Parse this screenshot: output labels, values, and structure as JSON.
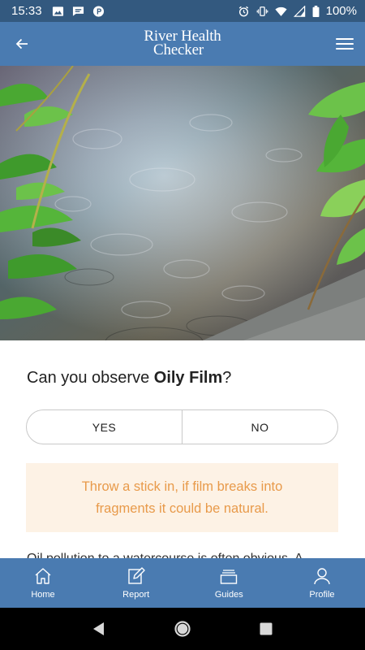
{
  "status_bar": {
    "time": "15:33",
    "battery_percent": "100%",
    "left_icons": [
      "image-icon",
      "message-icon",
      "p-app-icon"
    ],
    "right_icons": [
      "alarm-icon",
      "vibrate-icon",
      "wifi-icon",
      "signal-icon",
      "battery-icon"
    ]
  },
  "header": {
    "brand_line1": "River Health",
    "brand_line2": "Checker",
    "back_icon": "back-arrow-icon",
    "menu_icon": "hamburger-menu-icon"
  },
  "hero": {
    "image": "photo of stream water surface with oily sheen and green leaves"
  },
  "question": {
    "prefix": "Can you observe ",
    "subject": "Oily Film",
    "suffix": "?"
  },
  "choices": {
    "yes_label": "YES",
    "no_label": "NO"
  },
  "tip": {
    "text": "Throw a stick in, if film breaks into fragments it could be natural."
  },
  "body": {
    "text": "Oil pollution to a watercourse is often obvious. A"
  },
  "tabs": [
    {
      "label": "Home",
      "icon": "home-icon"
    },
    {
      "label": "Report",
      "icon": "edit-icon"
    },
    {
      "label": "Guides",
      "icon": "guides-icon"
    },
    {
      "label": "Profile",
      "icon": "profile-icon"
    }
  ],
  "nav": {
    "buttons": [
      "back-icon",
      "home-icon",
      "recents-icon"
    ]
  },
  "colors": {
    "status_bar": "#33597f",
    "header": "#4a7bb1",
    "tab_bar": "#4a7bb1",
    "tip_bg": "#fdf2e5",
    "tip_text": "#e89a4a"
  }
}
